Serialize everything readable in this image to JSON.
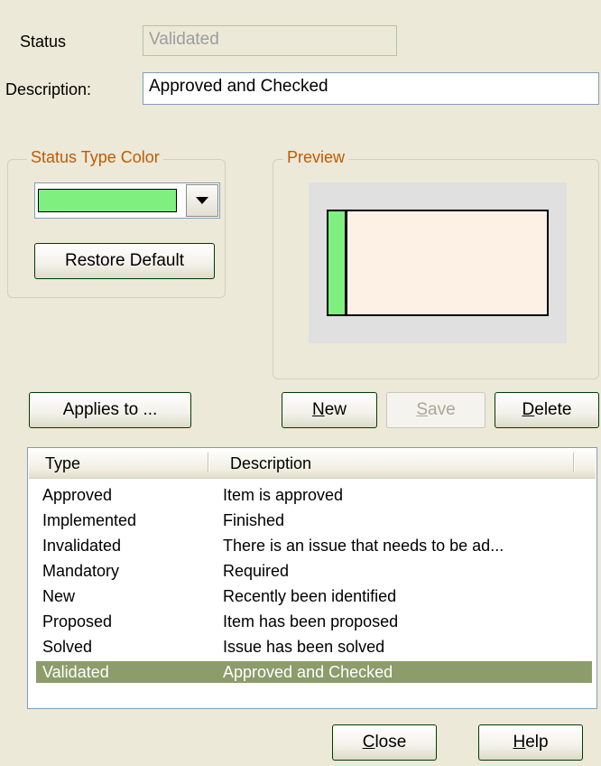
{
  "status": {
    "label": "Status",
    "value": "Validated"
  },
  "description": {
    "label": "Description:",
    "value": "Approved and Checked"
  },
  "status_type_color": {
    "title": "Status Type Color",
    "color": "#7FF07F",
    "restore_default_label": "Restore Default"
  },
  "preview": {
    "title": "Preview"
  },
  "buttons": {
    "applies_to": "Applies to ...",
    "new_u": "N",
    "new_rest": "ew",
    "save_u": "S",
    "save_rest": "ave",
    "delete_u": "D",
    "delete_rest": "elete",
    "close_u": "C",
    "close_rest": "lose",
    "help_u": "H",
    "help_rest": "elp"
  },
  "table": {
    "columns": [
      "Type",
      "Description"
    ],
    "rows": [
      {
        "type": "Approved",
        "description": "Item is approved"
      },
      {
        "type": "Implemented",
        "description": "Finished"
      },
      {
        "type": "Invalidated",
        "description": "There is an issue that needs to be ad..."
      },
      {
        "type": "Mandatory",
        "description": "Required"
      },
      {
        "type": "New",
        "description": "Recently been identified"
      },
      {
        "type": "Proposed",
        "description": "Item has been proposed"
      },
      {
        "type": "Solved",
        "description": "Issue has been solved"
      },
      {
        "type": "Validated",
        "description": "Approved and Checked"
      }
    ],
    "selected_index": 7
  },
  "colors": {
    "selection": "#8C9C6A",
    "group_title": "#C25A00",
    "preview_bar": "#7FF07F"
  }
}
